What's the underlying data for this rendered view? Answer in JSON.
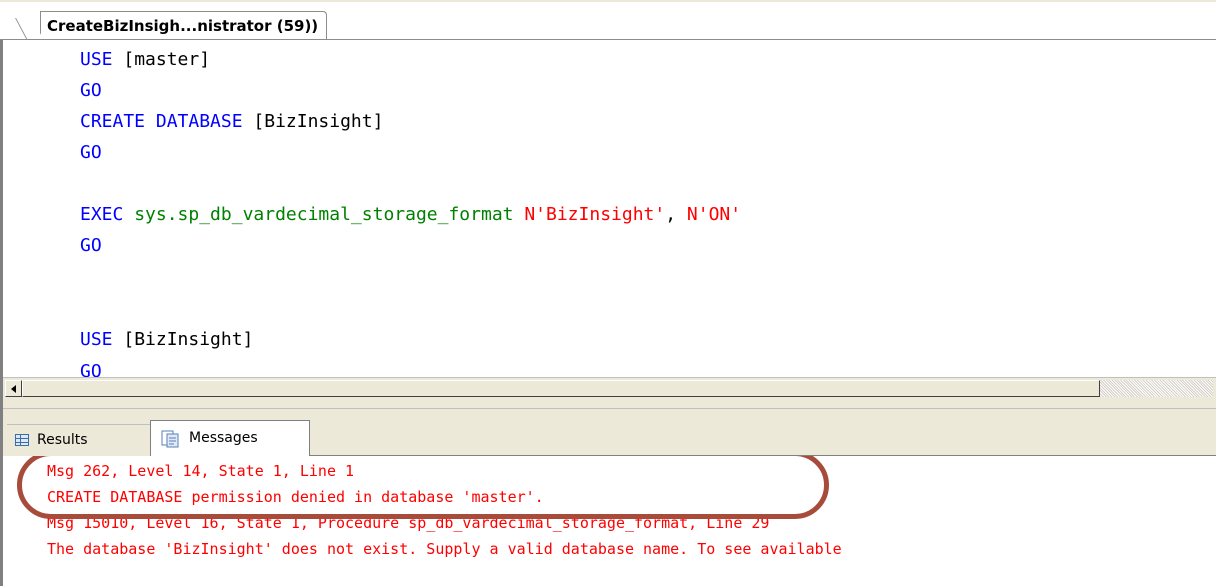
{
  "document_tab": {
    "title": "CreateBizInsigh...nistrator (59))"
  },
  "editor": {
    "lines": {
      "l1": {
        "kw": "USE",
        "rest": " [master]"
      },
      "l2": {
        "kw": "GO"
      },
      "l3": {
        "kw": "CREATE DATABASE",
        "rest": " [BizInsight]"
      },
      "l4": {
        "kw": "GO"
      },
      "l5": {
        "kw": "EXEC",
        "sys": " sys.sp_db_vardecimal_storage_format",
        "str1": " N'BizInsight'",
        "comma": ",",
        "str2": " N'ON'"
      },
      "l6": {
        "kw": "GO"
      },
      "l7": {
        "kw": "USE",
        "rest": " [BizInsight]"
      },
      "l8": {
        "kw": "GO"
      }
    }
  },
  "result_tabs": {
    "results_label": "Results",
    "messages_label": "Messages"
  },
  "messages": {
    "line1": "Msg 262, Level 14, State 1, Line 1",
    "line2": "CREATE DATABASE permission denied in database 'master'.",
    "line3": "Msg 15010, Level 16, State 1, Procedure sp_db_vardecimal_storage_format, Line 29",
    "line4": "The database 'BizInsight' does not exist. Supply a valid database name. To see available"
  },
  "colors": {
    "keyword": "#0000ff",
    "system_object": "#008000",
    "string_literal": "#ff0000",
    "error_text": "#ff0000",
    "annotation_ellipse": "#a74b3a"
  }
}
